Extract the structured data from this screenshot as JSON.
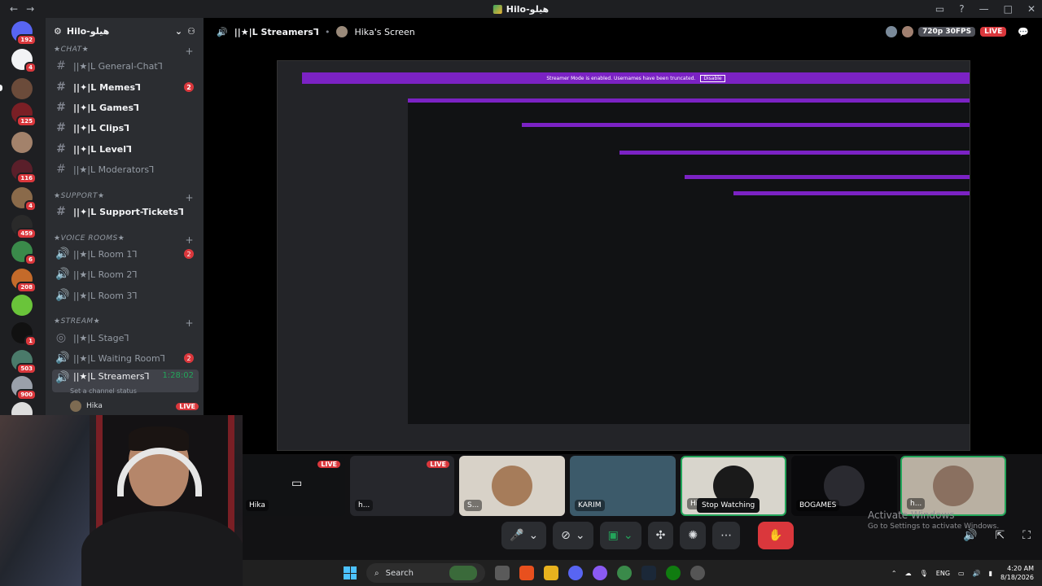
{
  "titlebar": {
    "title": "Hilo-هيلو"
  },
  "rail": {
    "badges": [
      "192",
      "4",
      "125",
      "116",
      "4",
      "459",
      "6",
      "208",
      "1",
      "503",
      "900"
    ]
  },
  "sidebar": {
    "guild_name": "Hilo-هيلو",
    "cat_chat": "★CHAT★",
    "cat_support": "★SUPPORT★",
    "cat_voice": "★VOICE ROOMS★",
    "cat_stream": "★STREAM★",
    "channels": {
      "general": "||★|L General-Chat⅂",
      "memes": "||✦|L Memes⅂",
      "games": "||✦|L Games⅂",
      "clips": "||✦|L Clips⅂",
      "level": "||✦|L Level⅂",
      "moderators": "||★|L Moderators⅂",
      "support": "||✦|L Support-Tickets⅂",
      "room1": "||★|L Room 1⅂",
      "room2": "||★|L Room 2⅂",
      "room3": "||★|L Room 3⅂",
      "stage": "||★|L Stage⅂",
      "waiting": "||★|L Waiting Room⅂",
      "streamers": "||★|L Streamers⅂"
    },
    "counts": {
      "memes": "2",
      "room1": "2",
      "waiting": "2"
    },
    "streamers_time": "1:28:02",
    "channel_status": "Set a channel status",
    "voice_user": "Hika",
    "live_label": "LIVE"
  },
  "stream_header": {
    "channel": "||★|L Streamers⅂",
    "screen_title": "Hika's Screen",
    "quality": "720p 30FPS",
    "live": "LIVE"
  },
  "stream_inner": {
    "banner": "Streamer Mode is enabled. Usernames have been truncated.",
    "disable": "Disable"
  },
  "tiles": [
    {
      "label": "Hika",
      "live": ""
    },
    {
      "label": "",
      "live": "LIVE"
    },
    {
      "label": "h...",
      "live": "LIVE"
    },
    {
      "label": "S...",
      "live": ""
    },
    {
      "label": "KARIM",
      "live": ""
    },
    {
      "label": "Hi...",
      "live": ""
    },
    {
      "label": "BOGAMES",
      "live": ""
    },
    {
      "label": "h...",
      "live": ""
    }
  ],
  "tooltip": "Stop Watching",
  "activate": {
    "line1": "Activate Windows",
    "line2": "Go to Settings to activate Windows."
  },
  "taskbar": {
    "search": "Search",
    "lang": "ENG",
    "time": "4:20 AM",
    "date": "8/18/2026"
  }
}
